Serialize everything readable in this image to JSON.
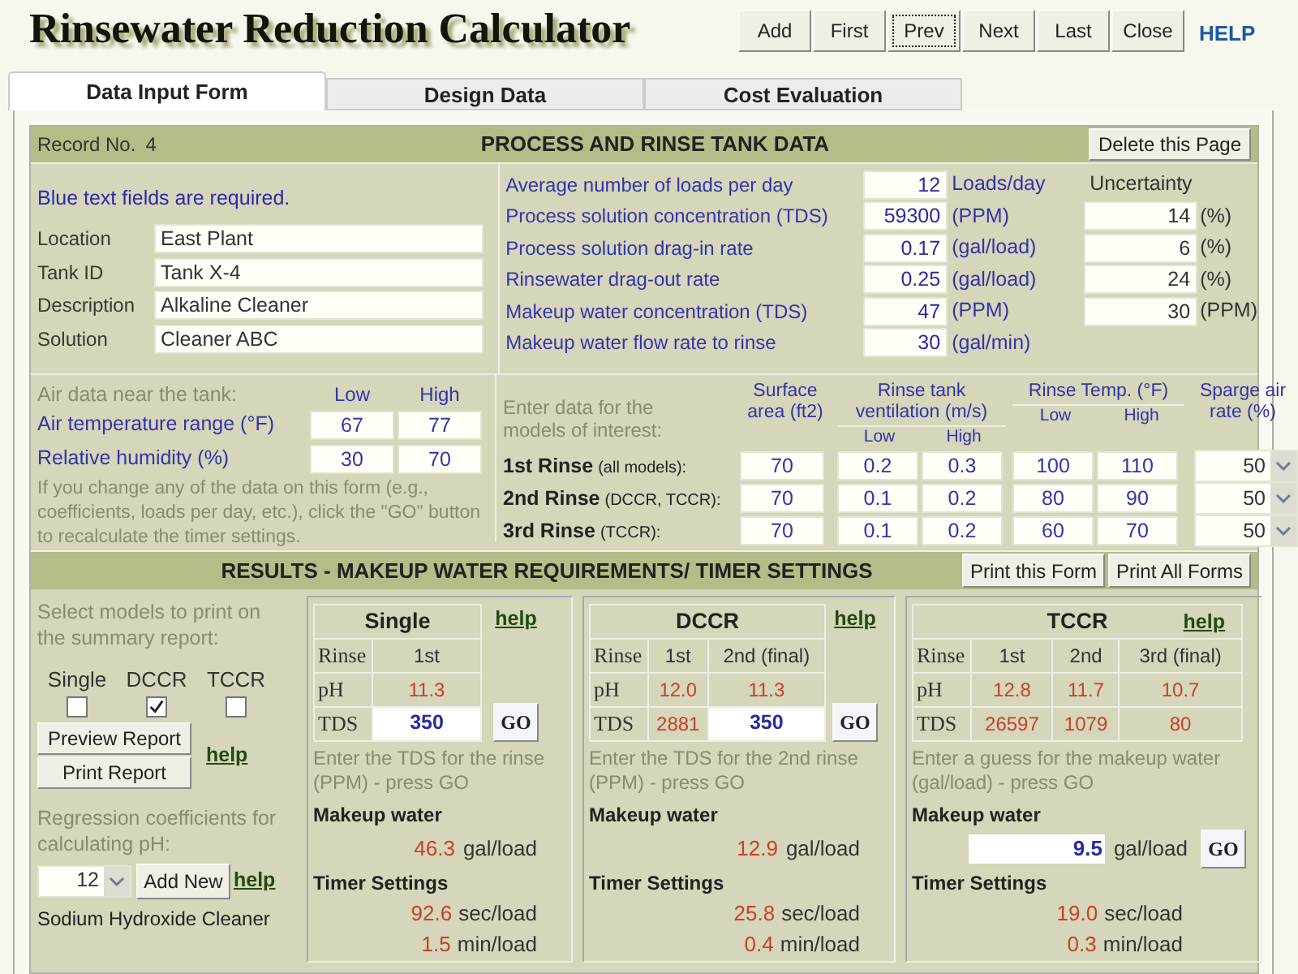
{
  "title": "Rinsewater Reduction Calculator",
  "nav_buttons": [
    {
      "label": "Add",
      "focused": false
    },
    {
      "label": "First",
      "focused": false
    },
    {
      "label": "Prev",
      "focused": true
    },
    {
      "label": "Next",
      "focused": false
    },
    {
      "label": "Last",
      "focused": false
    },
    {
      "label": "Close",
      "focused": false
    }
  ],
  "help_link": "HELP",
  "tabs": [
    {
      "label": "Data Input Form",
      "selected": true
    },
    {
      "label": "Design Data",
      "selected": false
    },
    {
      "label": "Cost Evaluation",
      "selected": false
    }
  ],
  "process": {
    "record_label": "Record No.",
    "record_number": "4",
    "title": "PROCESS AND RINSE TANK DATA",
    "delete_button": "Delete this Page",
    "required_note": "Blue text fields are required.",
    "info_fields": [
      {
        "label": "Location",
        "value": "East Plant"
      },
      {
        "label": "Tank ID",
        "value": "Tank X-4"
      },
      {
        "label": "Description",
        "value": "Alkaline Cleaner"
      },
      {
        "label": "Solution",
        "value": "Cleaner ABC"
      }
    ],
    "uncertainty_header": "Uncertainty",
    "process_fields": [
      {
        "label": "Average number of loads per day",
        "value": "12",
        "unit": "Loads/day"
      },
      {
        "label": "Process solution concentration (TDS)",
        "value": "59300",
        "unit": "(PPM)",
        "uncertainty": "14",
        "uncertainty_unit": "(%)"
      },
      {
        "label": "Process solution drag-in rate",
        "value": "0.17",
        "unit": "(gal/load)",
        "uncertainty": "6",
        "uncertainty_unit": "(%)"
      },
      {
        "label": "Rinsewater drag-out rate",
        "value": "0.25",
        "unit": "(gal/load)",
        "uncertainty": "24",
        "uncertainty_unit": "(%)"
      },
      {
        "label": "Makeup water concentration (TDS)",
        "value": "47",
        "unit": "(PPM)",
        "uncertainty": "30",
        "uncertainty_unit": "(PPM)"
      },
      {
        "label": "Makeup water flow rate to rinse",
        "value": "30",
        "unit": "(gal/min)"
      }
    ],
    "air": {
      "heading": "Air data near the tank:",
      "low_header": "Low",
      "high_header": "High",
      "rows": [
        {
          "label": "Air temperature range (°F)",
          "low": "67",
          "high": "77"
        },
        {
          "label": "Relative humidity (%)",
          "low": "30",
          "high": "70"
        }
      ]
    },
    "recalc_note": "If you change any of the data on this form (e.g., coefficients, loads per day, etc.), click the \"GO\" button to recalculate the timer settings.",
    "rinse": {
      "intro": "Enter data for the models of interest:",
      "area_header": "Surface area (ft2)",
      "vent_header": "Rinse tank ventilation (m/s)",
      "vent_low_header": "Low",
      "vent_high_header": "High",
      "temp_header": "Rinse Temp. (°F)",
      "temp_low_header": "Low",
      "temp_high_header": "High",
      "sparge_header": "Sparge air rate (%)",
      "rows": [
        {
          "name": "1st Rinse",
          "scope": "(all models):",
          "area": "70",
          "vent_low": "0.2",
          "vent_high": "0.3",
          "temp_low": "100",
          "temp_high": "110",
          "sparge": "50"
        },
        {
          "name": "2nd Rinse",
          "scope": "(DCCR, TCCR):",
          "area": "70",
          "vent_low": "0.1",
          "vent_high": "0.2",
          "temp_low": "80",
          "temp_high": "90",
          "sparge": "50"
        },
        {
          "name": "3rd Rinse",
          "scope": "(TCCR):",
          "area": "70",
          "vent_low": "0.1",
          "vent_high": "0.2",
          "temp_low": "60",
          "temp_high": "70",
          "sparge": "50"
        }
      ]
    }
  },
  "results": {
    "title": "RESULTS - MAKEUP WATER REQUIREMENTS/ TIMER SETTINGS",
    "buttons": [
      "Print this Form",
      "Print All Forms"
    ],
    "print_prompt": "Select models to print on the summary report:",
    "print_models": [
      {
        "label": "Single",
        "checked": false
      },
      {
        "label": "DCCR",
        "checked": true
      },
      {
        "label": "TCCR",
        "checked": false
      }
    ],
    "preview_button": "Preview Report",
    "print_button": "Print Report",
    "report_help": "help",
    "regression_prompt": "Regression coefficients for calculating pH:",
    "regression_value": "12",
    "add_new_button": "Add New",
    "regression_help": "help",
    "cleaner": "Sodium Hydroxide Cleaner",
    "models": [
      {
        "name": "Single",
        "help": "help",
        "row_labels": [
          "Rinse",
          "pH",
          "TDS"
        ],
        "rinses": [
          "1st"
        ],
        "ph": [
          {
            "value": "11.3",
            "kind": "output"
          }
        ],
        "tds": [
          {
            "value": "350",
            "kind": "input"
          }
        ],
        "tds_go": "GO",
        "hint": "Enter the TDS for the rinse (PPM) - press GO",
        "makeup_label": "Makeup water",
        "makeup": {
          "value": "46.3",
          "kind": "output"
        },
        "makeup_unit": "gal/load",
        "timer_label": "Timer Settings",
        "sec": "92.6",
        "sec_unit": "sec/load",
        "min": "1.5",
        "min_unit": "min/load"
      },
      {
        "name": "DCCR",
        "help": "help",
        "row_labels": [
          "Rinse",
          "pH",
          "TDS"
        ],
        "rinses": [
          "1st",
          "2nd (final)"
        ],
        "ph": [
          {
            "value": "12.0",
            "kind": "output"
          },
          {
            "value": "11.3",
            "kind": "output"
          }
        ],
        "tds": [
          {
            "value": "2881",
            "kind": "output"
          },
          {
            "value": "350",
            "kind": "input"
          }
        ],
        "tds_go": "GO",
        "hint": "Enter the TDS for the 2nd rinse (PPM) - press GO",
        "makeup_label": "Makeup water",
        "makeup": {
          "value": "12.9",
          "kind": "output"
        },
        "makeup_unit": "gal/load",
        "timer_label": "Timer Settings",
        "sec": "25.8",
        "sec_unit": "sec/load",
        "min": "0.4",
        "min_unit": "min/load"
      },
      {
        "name": "TCCR",
        "help": "help",
        "row_labels": [
          "Rinse",
          "pH",
          "TDS"
        ],
        "rinses": [
          "1st",
          "2nd",
          "3rd (final)"
        ],
        "ph": [
          {
            "value": "12.8",
            "kind": "output"
          },
          {
            "value": "11.7",
            "kind": "output"
          },
          {
            "value": "10.7",
            "kind": "output"
          }
        ],
        "tds": [
          {
            "value": "26597",
            "kind": "output"
          },
          {
            "value": "1079",
            "kind": "output"
          },
          {
            "value": "80",
            "kind": "output"
          }
        ],
        "hint": "Enter a guess for the makeup water (gal/load) - press GO",
        "makeup_label": "Makeup water",
        "makeup": {
          "value": "9.5",
          "kind": "input"
        },
        "makeup_unit": "gal/load",
        "makeup_go": "GO",
        "timer_label": "Timer Settings",
        "sec": "19.0",
        "sec_unit": "sec/load",
        "min": "0.3",
        "min_unit": "min/load"
      }
    ]
  }
}
